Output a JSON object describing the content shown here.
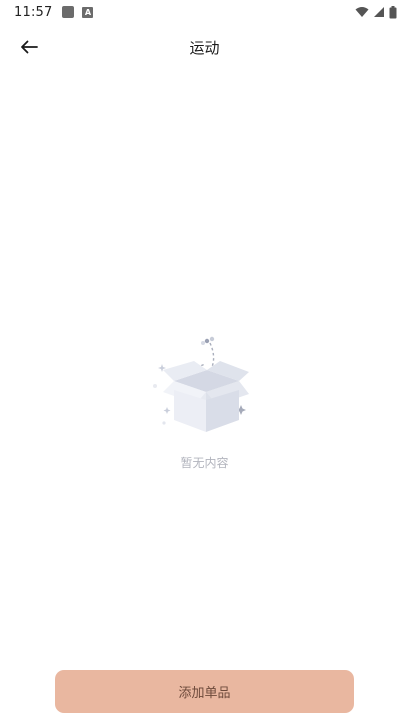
{
  "status_bar": {
    "time": "11:57",
    "left_icons": [
      "notification-square-icon",
      "a-box-icon"
    ],
    "right_icons": [
      "wifi-icon",
      "signal-icon",
      "battery-icon"
    ]
  },
  "app_bar": {
    "back_icon": "arrow-left-icon",
    "title": "运动"
  },
  "empty_state": {
    "illustration": "open-box-icon",
    "message": "暂无内容"
  },
  "footer": {
    "add_button_label": "添加单品"
  },
  "colors": {
    "button_bg": "#e9b7a0",
    "button_text": "#6d4a3b",
    "empty_text": "#b2b4bd"
  }
}
